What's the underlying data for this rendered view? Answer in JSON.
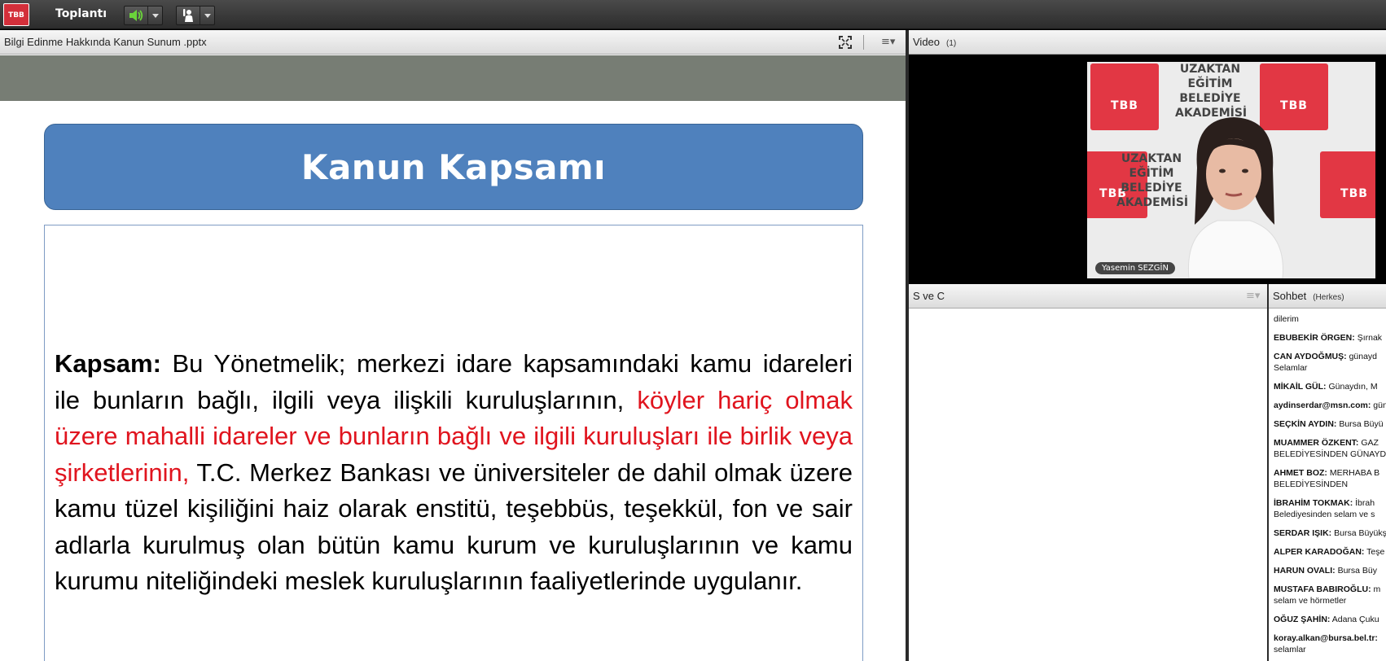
{
  "topbar": {
    "logo_text": "TBB",
    "meeting_menu": "Toplantı",
    "speaker_icon": "speaker-icon",
    "raise_hand_icon": "raise-hand-icon"
  },
  "share_pod": {
    "title": "Bilgi Edinme Hakkında Kanun Sunum .pptx",
    "slide": {
      "title": "Kanun Kapsamı",
      "label": "Kapsam:",
      "text_part1": " Bu Yönetmelik; merkezi idare kapsamındaki kamu idareleri ile bunların bağlı, ilgili veya ilişkili kuruluşlarının, ",
      "text_red": "köyler hariç olmak üzere mahalli idareler ve bunların bağlı ve ilgili kuruluşları ile birlik veya şirketlerinin,",
      "text_part2": " T.C. Merkez Bankası ve üniversiteler de dahil olmak üzere kamu tüzel kişiliğini haiz olarak enstitü, teşebbüs, teşekkül, fon ve sair adlarla kurulmuş olan bütün kamu kurum ve kuruluşlarının ve kamu kurumu niteliğindeki meslek kuruluşlarının faaliyetlerinde uygulanır."
    }
  },
  "video_pod": {
    "title": "Video",
    "count": "(1)",
    "bg_words": [
      "UZAKTAN",
      "EĞİTİM",
      "BELEDİYE",
      "AKADEMİSİ"
    ],
    "tile_text": "TBB",
    "presenter_name": "Yasemin SEZGİN"
  },
  "qa_pod": {
    "title": "S ve C"
  },
  "chat_pod": {
    "title": "Sohbet",
    "scope": "(Herkes)",
    "messages": [
      {
        "name": "",
        "text": "dilerim"
      },
      {
        "name": "EBUBEKİR ÖRGEN:",
        "text": "Şırnak"
      },
      {
        "name": "CAN AYDOĞMUŞ:",
        "text": "günayd",
        "text2": "Selamlar"
      },
      {
        "name": "MİKAİL GÜL:",
        "text": "Günaydın, M"
      },
      {
        "name": "aydinserdar@msn.com:",
        "text": "gün"
      },
      {
        "name": "SEÇKİN AYDIN:",
        "text": "Bursa Büyü"
      },
      {
        "name": "MUAMMER ÖZKENT:",
        "text": "GAZ",
        "text2": "BELEDİYESİNDEN GÜNAYD"
      },
      {
        "name": "AHMET BOZ:",
        "text": "MERHABA B",
        "text2": "BELEDİYESİNDEN"
      },
      {
        "name": "İBRAHİM TOKMAK:",
        "text": "İbrah",
        "text2": "Belediyesinden selam ve s"
      },
      {
        "name": "SERDAR IŞIK:",
        "text": "Bursa Büyükş"
      },
      {
        "name": "ALPER KARADOĞAN:",
        "text": "Teşe"
      },
      {
        "name": "HARUN OVALI:",
        "text": "Bursa Büy"
      },
      {
        "name": "MUSTAFA BABIROĞLU:",
        "text": "m",
        "text2": "selam ve hörmetler"
      },
      {
        "name": "OĞUZ ŞAHİN:",
        "text": "Adana Çuku"
      },
      {
        "name": "koray.alkan@bursa.bel.tr:",
        "text": "",
        "text2": "selamlar"
      }
    ]
  },
  "colors": {
    "accent_blue": "#4f81bd",
    "highlight_red": "#e0141e",
    "logo_red": "#d32f3a"
  }
}
